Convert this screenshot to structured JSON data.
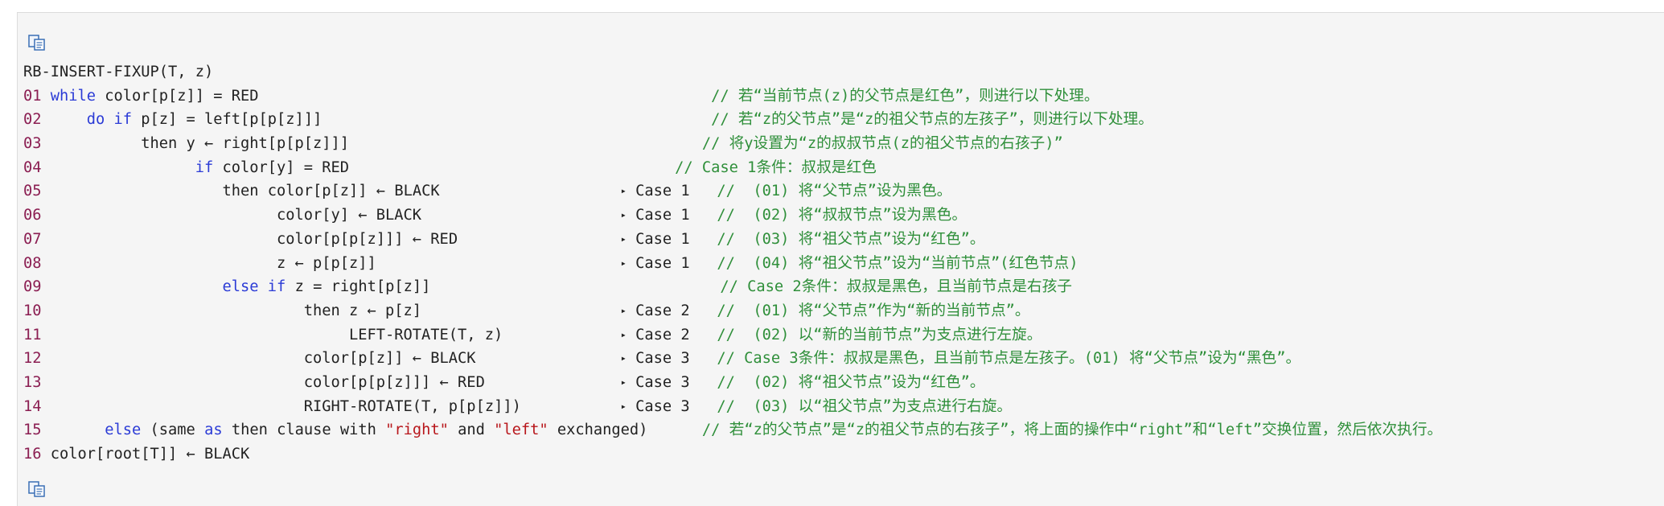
{
  "copy_icon": "copy-icon",
  "colors": {
    "line_number": "#8b1e52",
    "keyword": "#2b3bd6",
    "string": "#b8161b",
    "comment": "#2f8f3a",
    "text": "#222222",
    "background": "#f5f5f5"
  },
  "code": {
    "header": "RB-INSERT-FIXUP(T, z)",
    "lines": [
      {
        "num": "01",
        "indent": " ",
        "kw1": "while",
        "rest1": " color[p[z]] = RED",
        "pad": "                                                  ",
        "case": "",
        "cmt": "// 若“当前节点(z)的父节点是红色”，则进行以下处理。"
      },
      {
        "num": "02",
        "indent": "     ",
        "kw1": "do if",
        "rest1": " p[z] = left[p[p[z]]]",
        "pad": "                                           ",
        "case": "",
        "cmt": "// 若“z的父节点”是“z的祖父节点的左孩子”，则进行以下处理。"
      },
      {
        "num": "03",
        "indent": "           ",
        "kw1": "",
        "rest1": "then y ← right[p[p[z]]]",
        "pad": "                                       ",
        "case": "",
        "cmt": "// 将y设置为“z的叔叔节点(z的祖父节点的右孩子)”"
      },
      {
        "num": "04",
        "indent": "                 ",
        "kw1": "if",
        "rest1": " color[y] = RED",
        "pad": "                                    ",
        "case": "",
        "cmt": "// Case 1条件：叔叔是红色"
      },
      {
        "num": "05",
        "indent": "                    ",
        "kw1": "",
        "rest1": "then color[p[z]] ← BLACK",
        "pad": "                    ",
        "case": "Case 1",
        "cmt": "//  (01) 将“父节点”设为黑色。"
      },
      {
        "num": "06",
        "indent": "                          ",
        "kw1": "",
        "rest1": "color[y] ← BLACK",
        "pad": "                      ",
        "case": "Case 1",
        "cmt": "//  (02) 将“叔叔节点”设为黑色。"
      },
      {
        "num": "07",
        "indent": "                          ",
        "kw1": "",
        "rest1": "color[p[p[z]]] ← RED",
        "pad": "                  ",
        "case": "Case 1",
        "cmt": "//  (03) 将“祖父节点”设为“红色”。"
      },
      {
        "num": "08",
        "indent": "                          ",
        "kw1": "",
        "rest1": "z ← p[p[z]]",
        "pad": "                           ",
        "case": "Case 1",
        "cmt": "//  (04) 将“祖父节点”设为“当前节点”(红色节点)"
      },
      {
        "num": "09",
        "indent": "                    ",
        "kw1": "else if",
        "rest1": " z = right[p[z]]",
        "pad": "                                ",
        "case": "",
        "cmt": "// Case 2条件：叔叔是黑色，且当前节点是右孩子"
      },
      {
        "num": "10",
        "indent": "                             ",
        "kw1": "",
        "rest1": "then z ← p[z]",
        "pad": "                      ",
        "case": "Case 2",
        "cmt": "//  (01) 将“父节点”作为“新的当前节点”。"
      },
      {
        "num": "11",
        "indent": "                                  ",
        "kw1": "",
        "rest1": "LEFT-ROTATE(T, z)",
        "pad": "             ",
        "case": "Case 2",
        "cmt": "//  (02) 以“新的当前节点”为支点进行左旋。"
      },
      {
        "num": "12",
        "indent": "                             ",
        "kw1": "",
        "rest1": "color[p[z]] ← BLACK",
        "pad": "                ",
        "case": "Case 3",
        "cmt": "// Case 3条件：叔叔是黑色，且当前节点是左孩子。(01) 将“父节点”设为“黑色”。"
      },
      {
        "num": "13",
        "indent": "                             ",
        "kw1": "",
        "rest1": "color[p[p[z]]] ← RED",
        "pad": "               ",
        "case": "Case 3",
        "cmt": "//  (02) 将“祖父节点”设为“红色”。"
      },
      {
        "num": "14",
        "indent": "                             ",
        "kw1": "",
        "rest1": "RIGHT-ROTATE(T, p[p[z]])",
        "pad": "           ",
        "case": "Case 3",
        "cmt": "//  (03) 以“祖父节点”为支点进行右旋。"
      }
    ],
    "line15": {
      "num": "15",
      "indent": "       ",
      "kw_else": "else",
      "t1": " (same ",
      "kw_as": "as",
      "t2": " then clause with ",
      "s_right": "\"right\"",
      "t3": " and ",
      "s_left": "\"left\"",
      "t4": " exchanged)",
      "pad": "      ",
      "cmt": "// 若“z的父节点”是“z的祖父节点的右孩子”，将上面的操作中“right”和“left”交换位置，然后依次执行。"
    },
    "line16": {
      "num": "16",
      "text": " color[root[T]] ← BLACK"
    }
  }
}
